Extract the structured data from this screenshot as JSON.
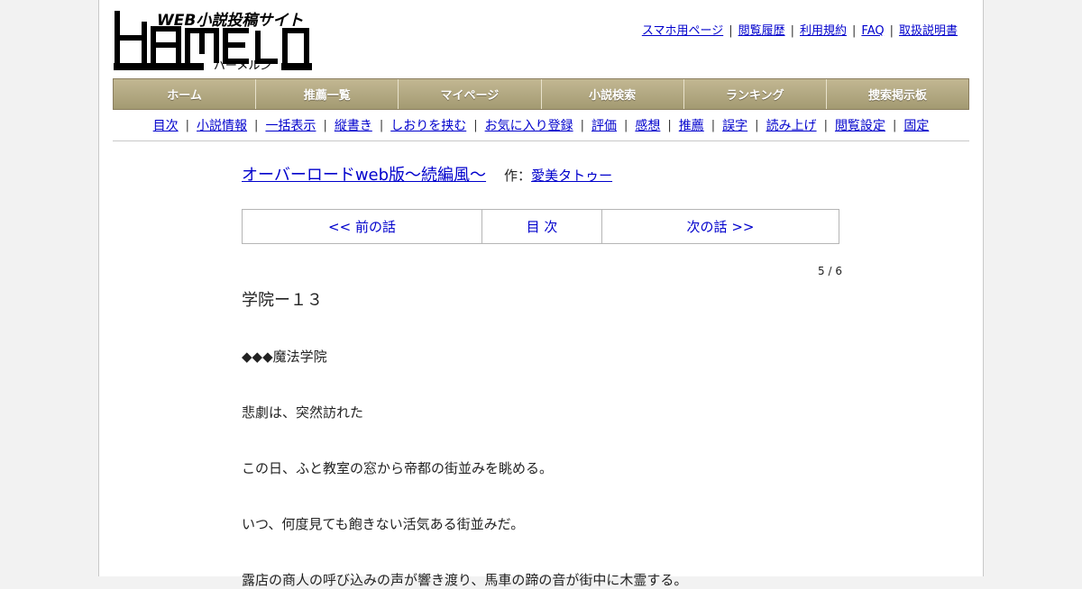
{
  "site": {
    "logo_text": "HAMELN",
    "logo_tagline": "WEB小説投稿サイト",
    "logo_reading": "ハーメルン"
  },
  "top_links": [
    "スマホ用ページ",
    "閲覧履歴",
    "利用規約",
    "FAQ",
    "取扱説明書"
  ],
  "main_nav": [
    "ホーム",
    "推薦一覧",
    "マイページ",
    "小説検索",
    "ランキング",
    "捜索掲示板"
  ],
  "sub_nav": [
    "目次",
    "小説情報",
    "一括表示",
    "縦書き",
    "しおりを挟む",
    "お気に入り登録",
    "評価",
    "感想",
    "推薦",
    "誤字",
    "読み上げ",
    "閲覧設定",
    "固定"
  ],
  "novel": {
    "title": "オーバーロードweb版〜続編風〜",
    "author_prefix": "作：",
    "author": "愛美タトゥー"
  },
  "chapter_nav": {
    "prev": "<< 前の話",
    "toc": "目 次",
    "next": "次の話 >>"
  },
  "counter": "5 / 6",
  "chapter_title": "学院ー１３",
  "body_lines": [
    "◆◆◆魔法学院",
    "悲劇は、突然訪れた",
    "この日、ふと教室の窓から帝都の街並みを眺める。",
    "いつ、何度見ても飽きない活気ある街並みだ。",
    "露店の商人の呼び込みの声が響き渡り、馬車の蹄の音が街中に木霊する。"
  ],
  "colors": {
    "nav_gradient_top": "#c2b792",
    "nav_gradient_bottom": "#a39a72",
    "link": "#0000cc",
    "page_bg": "#f2f2f2"
  }
}
